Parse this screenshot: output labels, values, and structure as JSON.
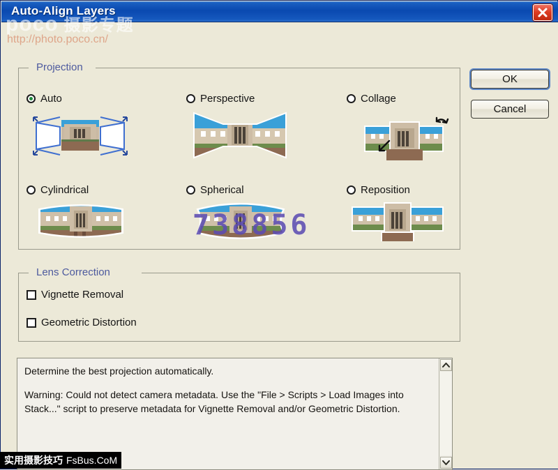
{
  "window": {
    "title": "Auto-Align Layers",
    "close_icon": "close-x-icon",
    "titlebar_color": "#0a49b0",
    "dialog_bg": "#ece9d8"
  },
  "projection": {
    "group_label": "Projection",
    "group_label_color": "#4d5a9e",
    "selected": "Auto",
    "options": [
      {
        "id": "auto",
        "label": "Auto",
        "selected": true,
        "thumb": "auto-projection-thumbnail"
      },
      {
        "id": "perspective",
        "label": "Perspective",
        "selected": false,
        "thumb": "perspective-projection-thumbnail"
      },
      {
        "id": "collage",
        "label": "Collage",
        "selected": false,
        "thumb": "collage-projection-thumbnail"
      },
      {
        "id": "cylindrical",
        "label": "Cylindrical",
        "selected": false,
        "thumb": "cylindrical-projection-thumbnail"
      },
      {
        "id": "spherical",
        "label": "Spherical",
        "selected": false,
        "thumb": "spherical-projection-thumbnail"
      },
      {
        "id": "reposition",
        "label": "Reposition",
        "selected": false,
        "thumb": "reposition-projection-thumbnail"
      }
    ]
  },
  "lens_correction": {
    "group_label": "Lens Correction",
    "options": [
      {
        "id": "vignette",
        "label": "Vignette Removal",
        "checked": false
      },
      {
        "id": "geometric",
        "label": "Geometric Distortion",
        "checked": false
      }
    ]
  },
  "description": {
    "line1": "Determine the best projection automatically.",
    "line2": "Warning: Could not detect camera metadata. Use the \"File > Scripts > Load Images into Stack...\" script to preserve metadata for Vignette Removal and/or Geometric Distortion.",
    "scroll_up_icon": "chevron-up-icon",
    "scroll_down_icon": "chevron-down-icon"
  },
  "buttons": {
    "ok": "OK",
    "cancel": "Cancel",
    "default_focus": "OK",
    "focus_color": "#5b85c6"
  },
  "watermarks": {
    "brand": "poco",
    "brand_cn": "摄影专题",
    "url": "http://photo.poco.cn/",
    "number": "738856",
    "bottom_cn": "实用摄影技巧",
    "bottom_site": "FsBus.CoM"
  }
}
